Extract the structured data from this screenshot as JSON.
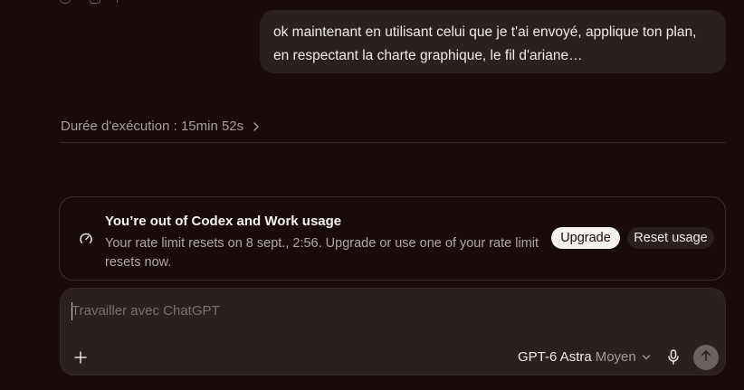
{
  "conversation": {
    "user_message": "ok maintenant en utilisant celui que je t'ai envoyé, applique ton plan, en respectant la charte graphique, le fil d'ariane…",
    "duration_label": "Durée d'exécution : 15min 52s"
  },
  "usage_notice": {
    "title": "You’re out of Codex and Work usage",
    "message": "Your rate limit resets on 8 sept., 2:56. Upgrade or use one of your rate limit resets now.",
    "upgrade_label": "Upgrade",
    "reset_label": "Reset usage"
  },
  "composer": {
    "placeholder": "Travailler avec ChatGPT",
    "value": "",
    "model_name": "GPT-6 Astra",
    "effort_level": "Moyen"
  },
  "icons": {
    "top_toolbar": [
      "copy-icon",
      "thumbs-icon",
      "share-icon"
    ],
    "duration": "chevron-right-icon",
    "notice": "gauge-icon",
    "attach": "plus-icon",
    "model_dropdown": "chevron-down-icon",
    "voice": "microphone-icon",
    "send": "arrow-up-icon"
  },
  "colors": {
    "background": "#1b0a0b",
    "bubble": "#2d1e1f",
    "upgrade_button": "#f6f2f2",
    "send_button": "#6d6262"
  }
}
